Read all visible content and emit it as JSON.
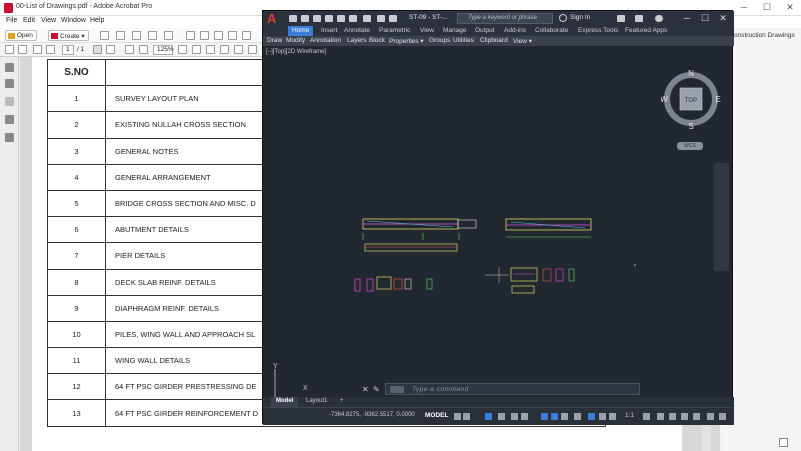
{
  "acrobat": {
    "window_title": "00-List of Drawings.pdf - Adobe Acrobat Pro",
    "window_controls": {
      "minimize": "─",
      "maximize": "☐",
      "close": "✕"
    },
    "menu": [
      "File",
      "Edit",
      "View",
      "Window",
      "Help"
    ],
    "toolbar": {
      "open_label": "Open",
      "create_label": "Create"
    },
    "page_nav": {
      "current_page": "1",
      "total_pages": "/ 1",
      "zoom": "125%"
    },
    "right_panel_text": "onstruction Drawings"
  },
  "schedule": {
    "header_no": "S.NO",
    "header_title": "",
    "rows": [
      {
        "no": "1",
        "title": "SURVEY LAYOUT PLAN"
      },
      {
        "no": "2",
        "title": "EXISTING NULLAH CROSS SECTION"
      },
      {
        "no": "3",
        "title": "GENERAL NOTES"
      },
      {
        "no": "4",
        "title": "GENERAL ARRANGEMENT"
      },
      {
        "no": "5",
        "title": "BRIDGE CROSS SECTION AND MISC. D"
      },
      {
        "no": "6",
        "title": "ABUTMENT DETAILS"
      },
      {
        "no": "7",
        "title": "PIER DETAILS"
      },
      {
        "no": "8",
        "title": "DECK SLAB REINF. DETAILS"
      },
      {
        "no": "9",
        "title": "DIAPHRAGM REINF. DETAILS"
      },
      {
        "no": "10",
        "title": "PILES, WING WALL AND APPROACH SL"
      },
      {
        "no": "11",
        "title": "WING WALL DETAILS"
      },
      {
        "no": "12",
        "title": "64 FT PSC GIRDER PRESTRESSING DE"
      },
      {
        "no": "13",
        "title": "64 FT PSC GIRDER REINFORCEMENT D"
      }
    ]
  },
  "autocad": {
    "logo_letter": "A",
    "file_name": "ST-09 - ST-...",
    "search_placeholder": "Type a keyword or phrase",
    "sign_in": "Sign In",
    "ribbon_tabs": [
      "Home",
      "Insert",
      "Annotate",
      "Parametric",
      "View",
      "Manage",
      "Output",
      "Add-ins",
      "Collaborate",
      "Express Tools",
      "Featured Apps"
    ],
    "active_tab": "Home",
    "panels": [
      "Draw",
      "Modify",
      "Annotation",
      "Layers",
      "Block",
      "Properties ▾",
      "Groups",
      "Utilities",
      "Clipboard",
      "View ▾"
    ],
    "view_label": "[−][Top][2D Wireframe]",
    "viewcube": {
      "north": "N",
      "south": "S",
      "east": "E",
      "west": "W",
      "face": "TOP",
      "wcs": "WCS"
    },
    "ucs": {
      "x": "X",
      "y": "Y"
    },
    "command_placeholder": "Type a command",
    "layout_tabs": [
      "Model",
      "Layout1",
      "+"
    ],
    "active_layout": "Model",
    "coordinates": "-7364.8275, -9362.5517, 0.0000",
    "space_label": "MODEL",
    "scale": "1:1",
    "colors": {
      "bg": "#212830",
      "ribbon": "#2c323d",
      "accent": "#3b7dd8"
    }
  }
}
